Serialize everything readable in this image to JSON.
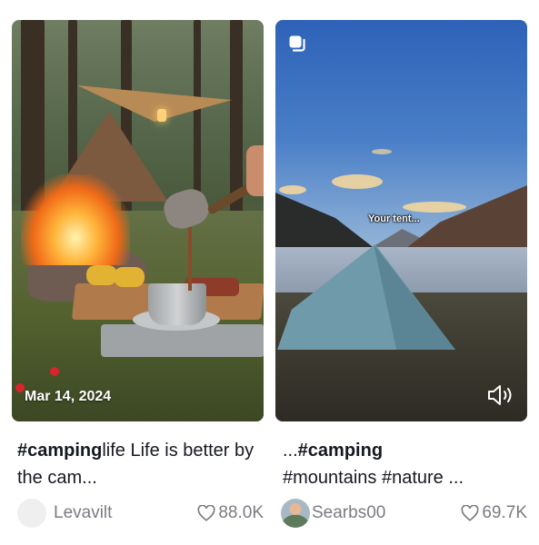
{
  "cards": [
    {
      "date": "Mar 14, 2024",
      "caption_bold": "#camping",
      "caption_rest": "life Life is better by the cam...",
      "author": "Levavilt",
      "likes": "88.0K",
      "icons": [
        "heart-icon"
      ]
    },
    {
      "overlay_text": "Your tent...",
      "caption_prefix": "...",
      "caption_bold": "#camping",
      "caption_rest": "#mountains #nature ...",
      "author": "Searbs00",
      "likes": "69.7K",
      "icons": [
        "multi-photo-icon",
        "sound-icon",
        "heart-icon"
      ]
    }
  ],
  "colors": {
    "text": "#161823",
    "muted": "#7a7c82",
    "background": "#ffffff"
  }
}
